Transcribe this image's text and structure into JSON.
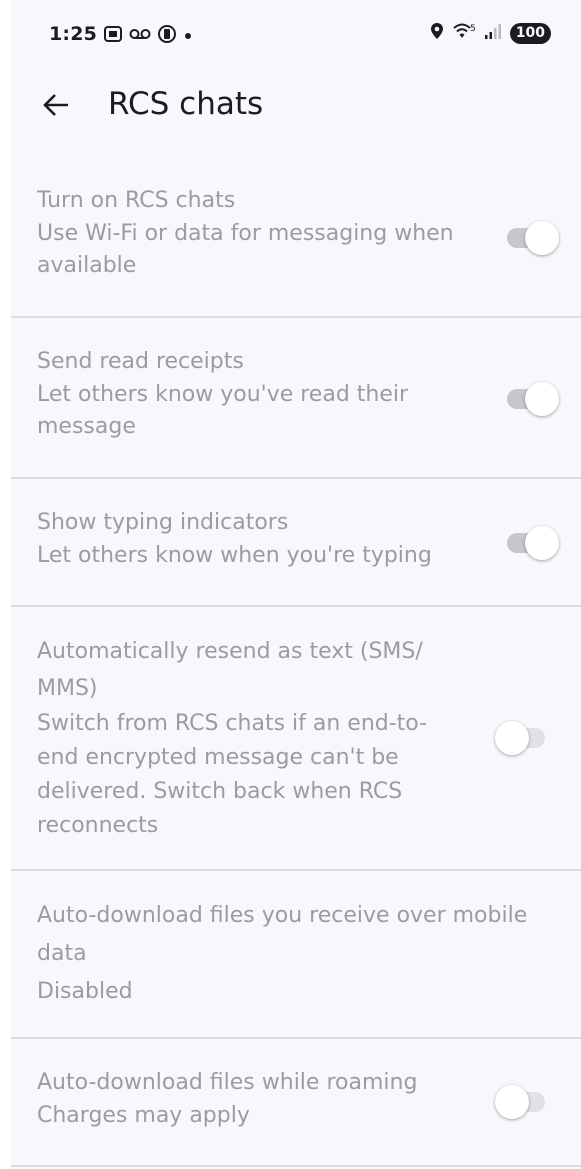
{
  "status_bar": {
    "time": "1:25",
    "battery": "100",
    "left_icons": [
      "screenshot-icon",
      "voicemail-icon",
      "data-saver-icon",
      "dot-icon"
    ],
    "right_icons": [
      "location-icon",
      "wifi-icon",
      "signal-icon"
    ],
    "wifi_badge": "5"
  },
  "app_bar": {
    "title": "RCS chats",
    "back_icon": "arrow-back-icon"
  },
  "settings": [
    {
      "title": "Turn on RCS chats",
      "summary": "Use Wi-Fi or data for messaging when available",
      "toggle": true,
      "enabled": false
    },
    {
      "title": "Send read receipts",
      "summary": "Let others know you've read their message",
      "toggle": true,
      "enabled": false
    },
    {
      "title": "Show typing indicators",
      "summary": "Let others know when you're typing",
      "toggle": true,
      "enabled": false
    },
    {
      "title": "Automatically resend as text (SMS/ MMS)",
      "summary": "Switch from RCS chats if an end-to-end encrypted message can't be delivered. Switch back when RCS reconnects",
      "toggle": false,
      "enabled": false
    },
    {
      "title": "Auto-download files you receive over mobile data",
      "summary": "Disabled",
      "enabled": false
    },
    {
      "title": "Auto-download files while roaming",
      "summary": "Charges may apply",
      "toggle": false,
      "enabled": false
    }
  ],
  "colors": {
    "background": "#f7f8fb",
    "text_primary": "#1c1c1e",
    "text_disabled": "#9b9ca0",
    "divider": "#dcdde0",
    "toggle_on_track": "#c6c7cb",
    "toggle_off_track": "#e1e2e5"
  }
}
